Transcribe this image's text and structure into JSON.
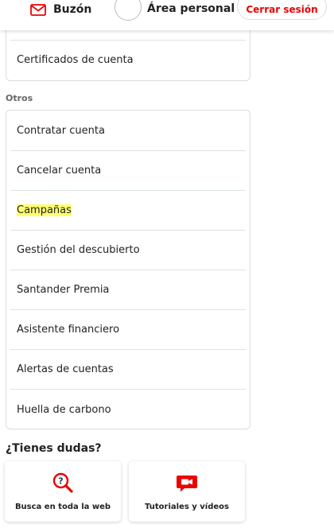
{
  "header": {
    "mailbox_label": "Buzón",
    "personal_area_label": "Área personal",
    "logout_label": "Cerrar sesión"
  },
  "account_section": {
    "items": [
      {
        "label": "Certificados de cuenta"
      }
    ]
  },
  "others_section": {
    "title": "Otros",
    "items": [
      {
        "label": "Contratar cuenta"
      },
      {
        "label": "Cancelar cuenta"
      },
      {
        "label": "Campañas",
        "highlighted": true
      },
      {
        "label": "Gestión del descubierto"
      },
      {
        "label": "Santander Premia"
      },
      {
        "label": "Asistente financiero"
      },
      {
        "label": "Alertas de cuentas"
      },
      {
        "label": "Huella de carbono"
      }
    ]
  },
  "help": {
    "title": "¿Tienes dudas?",
    "cards": [
      {
        "label": "Busca en toda la web",
        "icon": "search-question-icon"
      },
      {
        "label": "Tutoriales y vídeos",
        "icon": "video-camera-icon"
      }
    ]
  },
  "colors": {
    "brand_red": "#ec0000",
    "highlight": "#ffff6e",
    "divider": "#dde3e6"
  }
}
